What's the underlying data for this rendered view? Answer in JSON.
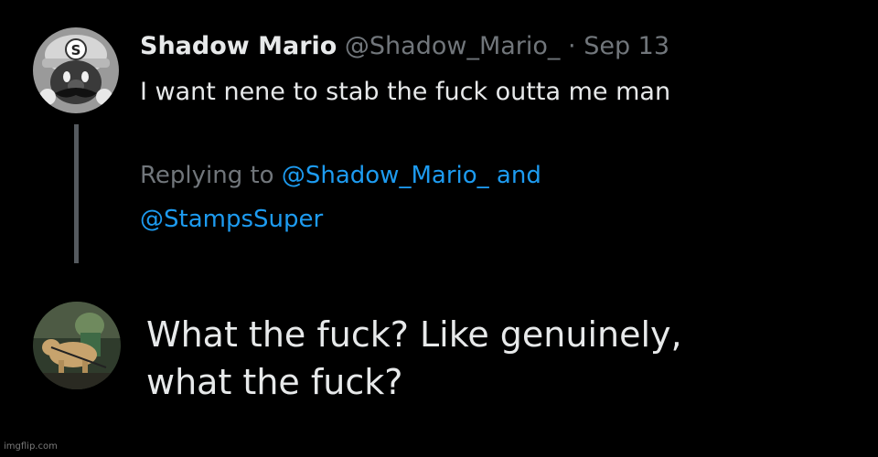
{
  "tweet": {
    "display_name": "Shadow Mario",
    "handle": "@Shadow_Mario_",
    "separator": "·",
    "date": "Sep 13",
    "text": "I want nene to stab the fuck outta me man"
  },
  "reply_context": {
    "prefix": "Replying to",
    "mention_1": "@Shadow_Mario_",
    "conjunction": "and",
    "mention_2": "@StampsSuper"
  },
  "reply": {
    "line_1": "What the fuck? Like genuinely,",
    "line_2": "what the fuck?"
  },
  "watermark": "imgflip.com",
  "colors": {
    "background": "#000000",
    "text_primary": "#e7e9ea",
    "text_secondary": "#71767b",
    "mention": "#1d9bf0",
    "thread_line": "#555a5f"
  },
  "icons": {
    "avatar_1": "mario-grayscale-avatar",
    "avatar_2": "dog-photo-avatar"
  }
}
